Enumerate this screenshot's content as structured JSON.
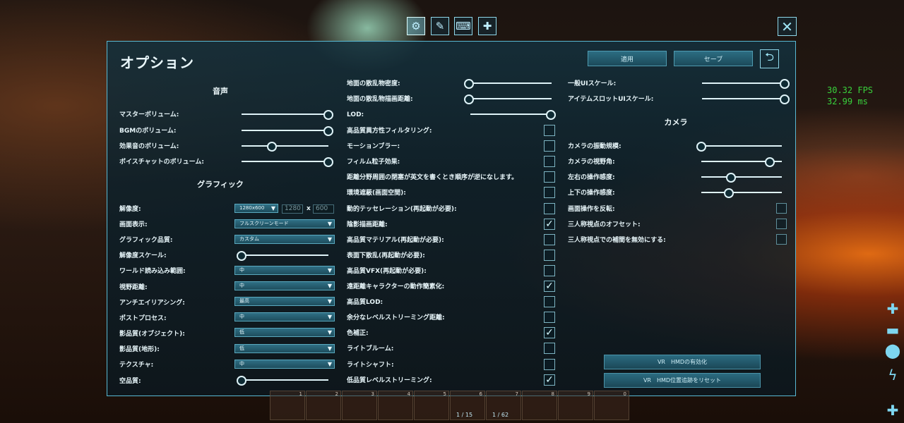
{
  "topbar": {
    "tabs": [
      {
        "name": "tab-options",
        "icon": "gear-icon",
        "glyph": "⚙"
      },
      {
        "name": "tab-graphics",
        "icon": "brush-icon",
        "glyph": "✎"
      },
      {
        "name": "tab-keyboard",
        "icon": "keyboard-icon",
        "glyph": "⌨"
      },
      {
        "name": "tab-gamepad",
        "icon": "gamepad-icon",
        "glyph": "✚"
      }
    ],
    "close_glyph": "✕"
  },
  "fps": {
    "line1": "30.32 FPS",
    "line2": "32.99 ms"
  },
  "panel": {
    "title": "オプション",
    "apply_label": "適用",
    "save_label": "セーブ",
    "back_glyph": "⮌"
  },
  "audio": {
    "header": "音声",
    "items": [
      {
        "label": "マスターボリューム:",
        "value": 1.0
      },
      {
        "label": "BGMのボリューム:",
        "value": 1.0
      },
      {
        "label": "効果音のボリューム:",
        "value": 0.35
      },
      {
        "label": "ボイスチャットのボリューム:",
        "value": 1.0
      }
    ]
  },
  "graphics": {
    "header": "グラフィック",
    "resolution_label": "解像度:",
    "resolution_value": "1280x600",
    "resolution_width": "1280",
    "resolution_x": "x",
    "resolution_height": "600",
    "display_label": "画面表示:",
    "display_value": "フルスクリーンモード",
    "quality_label": "グラフィック品質:",
    "quality_value": "カスタム",
    "res_scale_label": "解像度スケール:",
    "res_scale_value": 0.0,
    "world_load_label": "ワールド読み込み範囲:",
    "world_load_value": "中",
    "view_dist_label": "視野距離:",
    "view_dist_value": "中",
    "aa_label": "アンチエイリアシング:",
    "aa_value": "最高",
    "post_label": "ポストプロセス:",
    "post_value": "中",
    "shadow_obj_label": "影品質(オブジェクト):",
    "shadow_obj_value": "低",
    "shadow_terrain_label": "影品質(地形):",
    "shadow_terrain_value": "低",
    "texture_label": "テクスチャ:",
    "texture_value": "中",
    "sky_label": "空品質:",
    "sky_value": 0.0
  },
  "middle": {
    "sliders": [
      {
        "label": "地面の散乱物密度:",
        "value": 0.0
      },
      {
        "label": "地面の散乱物描画距離:",
        "value": 0.0
      },
      {
        "label": "LOD:",
        "value": 1.0
      }
    ],
    "checks": [
      {
        "label": "高品質異方性フィルタリング:",
        "checked": false
      },
      {
        "label": "モーションブラー:",
        "checked": false
      },
      {
        "label": "フィルム粒子効果:",
        "checked": false
      },
      {
        "label": "距離分野周囲の閉塞が英文を書くとき順序が逆になします。",
        "checked": false
      },
      {
        "label": "環境遮蔽(画面空間):",
        "checked": false
      },
      {
        "label": "動的テッセレーション(再起動が必要):",
        "checked": false
      },
      {
        "label": "陰影描画距離:",
        "checked": true
      },
      {
        "label": "高品質マテリアル(再起動が必要):",
        "checked": false
      },
      {
        "label": "表面下散乱(再起動が必要):",
        "checked": false
      },
      {
        "label": "高品質VFX(再起動が必要):",
        "checked": false
      },
      {
        "label": "遠距離キャラクターの動作簡素化:",
        "checked": true
      },
      {
        "label": "高品質LOD:",
        "checked": false
      },
      {
        "label": "余分なレベルストリーミング距離:",
        "checked": false
      },
      {
        "label": "色補正:",
        "checked": true
      },
      {
        "label": "ライトブルーム:",
        "checked": false
      },
      {
        "label": "ライトシャフト:",
        "checked": false
      },
      {
        "label": "低品質レベルストリーミング:",
        "checked": true
      }
    ]
  },
  "right": {
    "ui_scale_label": "一般UIスケール:",
    "ui_scale_value": 1.0,
    "slot_scale_label": "アイテムスロットUIスケール:",
    "slot_scale_value": 1.0,
    "camera_header": "カメラ",
    "camera_sliders": [
      {
        "label": "カメラの振動規模:",
        "value": 0.0
      },
      {
        "label": "カメラの視野角:",
        "value": 0.85
      },
      {
        "label": "左右の操作感度:",
        "value": 0.37
      },
      {
        "label": "上下の操作感度:",
        "value": 0.34
      }
    ],
    "camera_checks": [
      {
        "label": "画面操作を反転:",
        "checked": false
      },
      {
        "label": "三人称視点のオフセット:",
        "checked": false
      },
      {
        "label": "三人称視点での補間を無効にする:",
        "checked": false
      }
    ],
    "vr_enable_label": "VR　HMDの有効化",
    "vr_reset_label": "VR　HMD位置追跡をリセット"
  },
  "hotbar": {
    "slots": [
      {
        "num": "1",
        "count": ""
      },
      {
        "num": "2",
        "count": ""
      },
      {
        "num": "3",
        "count": ""
      },
      {
        "num": "4",
        "count": ""
      },
      {
        "num": "5",
        "count": ""
      },
      {
        "num": "6",
        "count": "1 / 15"
      },
      {
        "num": "7",
        "count": "1 / 62"
      },
      {
        "num": "8",
        "count": ""
      },
      {
        "num": "9",
        "count": ""
      },
      {
        "num": "0",
        "count": ""
      }
    ]
  },
  "side_icons": [
    "plus-icon",
    "bar-icon",
    "stop-icon",
    "lightning-icon",
    "plus-icon"
  ]
}
